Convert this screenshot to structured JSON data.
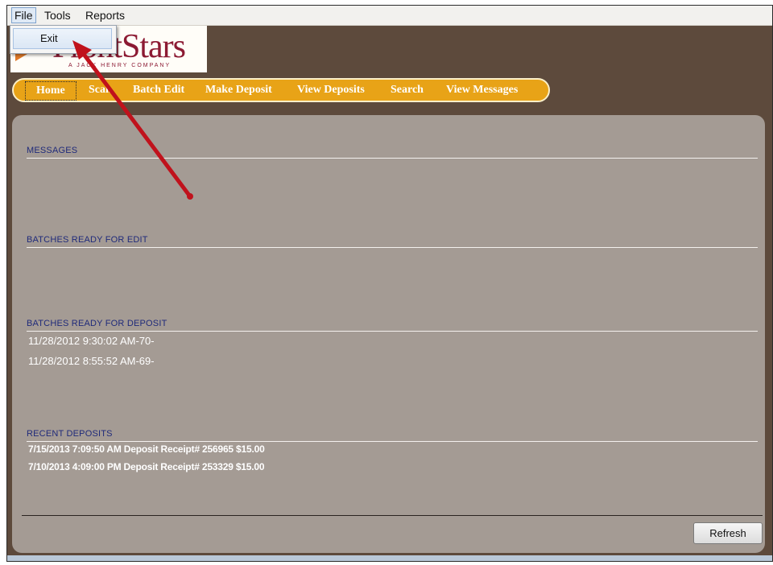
{
  "menubar": {
    "items": [
      "File",
      "Tools",
      "Reports"
    ],
    "file_menu": {
      "items": [
        "Exit"
      ]
    }
  },
  "logo": {
    "text": "FrontStars",
    "tagline": "A JACK HENRY COMPANY"
  },
  "nav": {
    "items": [
      "Home",
      "Scan",
      "Batch Edit",
      "Make Deposit",
      "View Deposits",
      "Search",
      "View Messages"
    ],
    "active": "Home"
  },
  "sections": {
    "messages": {
      "title": "MESSAGES",
      "items": []
    },
    "batches_edit": {
      "title": "BATCHES READY FOR EDIT",
      "items": []
    },
    "batches_deposit": {
      "title": "BATCHES READY FOR DEPOSIT",
      "items": [
        "11/28/2012 9:30:02 AM-70-",
        "11/28/2012 8:55:52 AM-69-"
      ]
    },
    "recent_deposits": {
      "title": "RECENT DEPOSITS",
      "items": [
        "7/15/2013 7:09:50 AM Deposit Receipt# 256965 $15.00",
        "7/10/2013 4:09:00 PM Deposit Receipt# 253329 $15.00"
      ]
    }
  },
  "buttons": {
    "refresh": "Refresh"
  },
  "colors": {
    "background": "#5d4a3c",
    "panel": "#a49b94",
    "nav": "#e8a317",
    "section_title": "#1f2a7a",
    "annotation_arrow": "#c0121c"
  },
  "annotation": {
    "type": "arrow",
    "target": "Exit"
  }
}
